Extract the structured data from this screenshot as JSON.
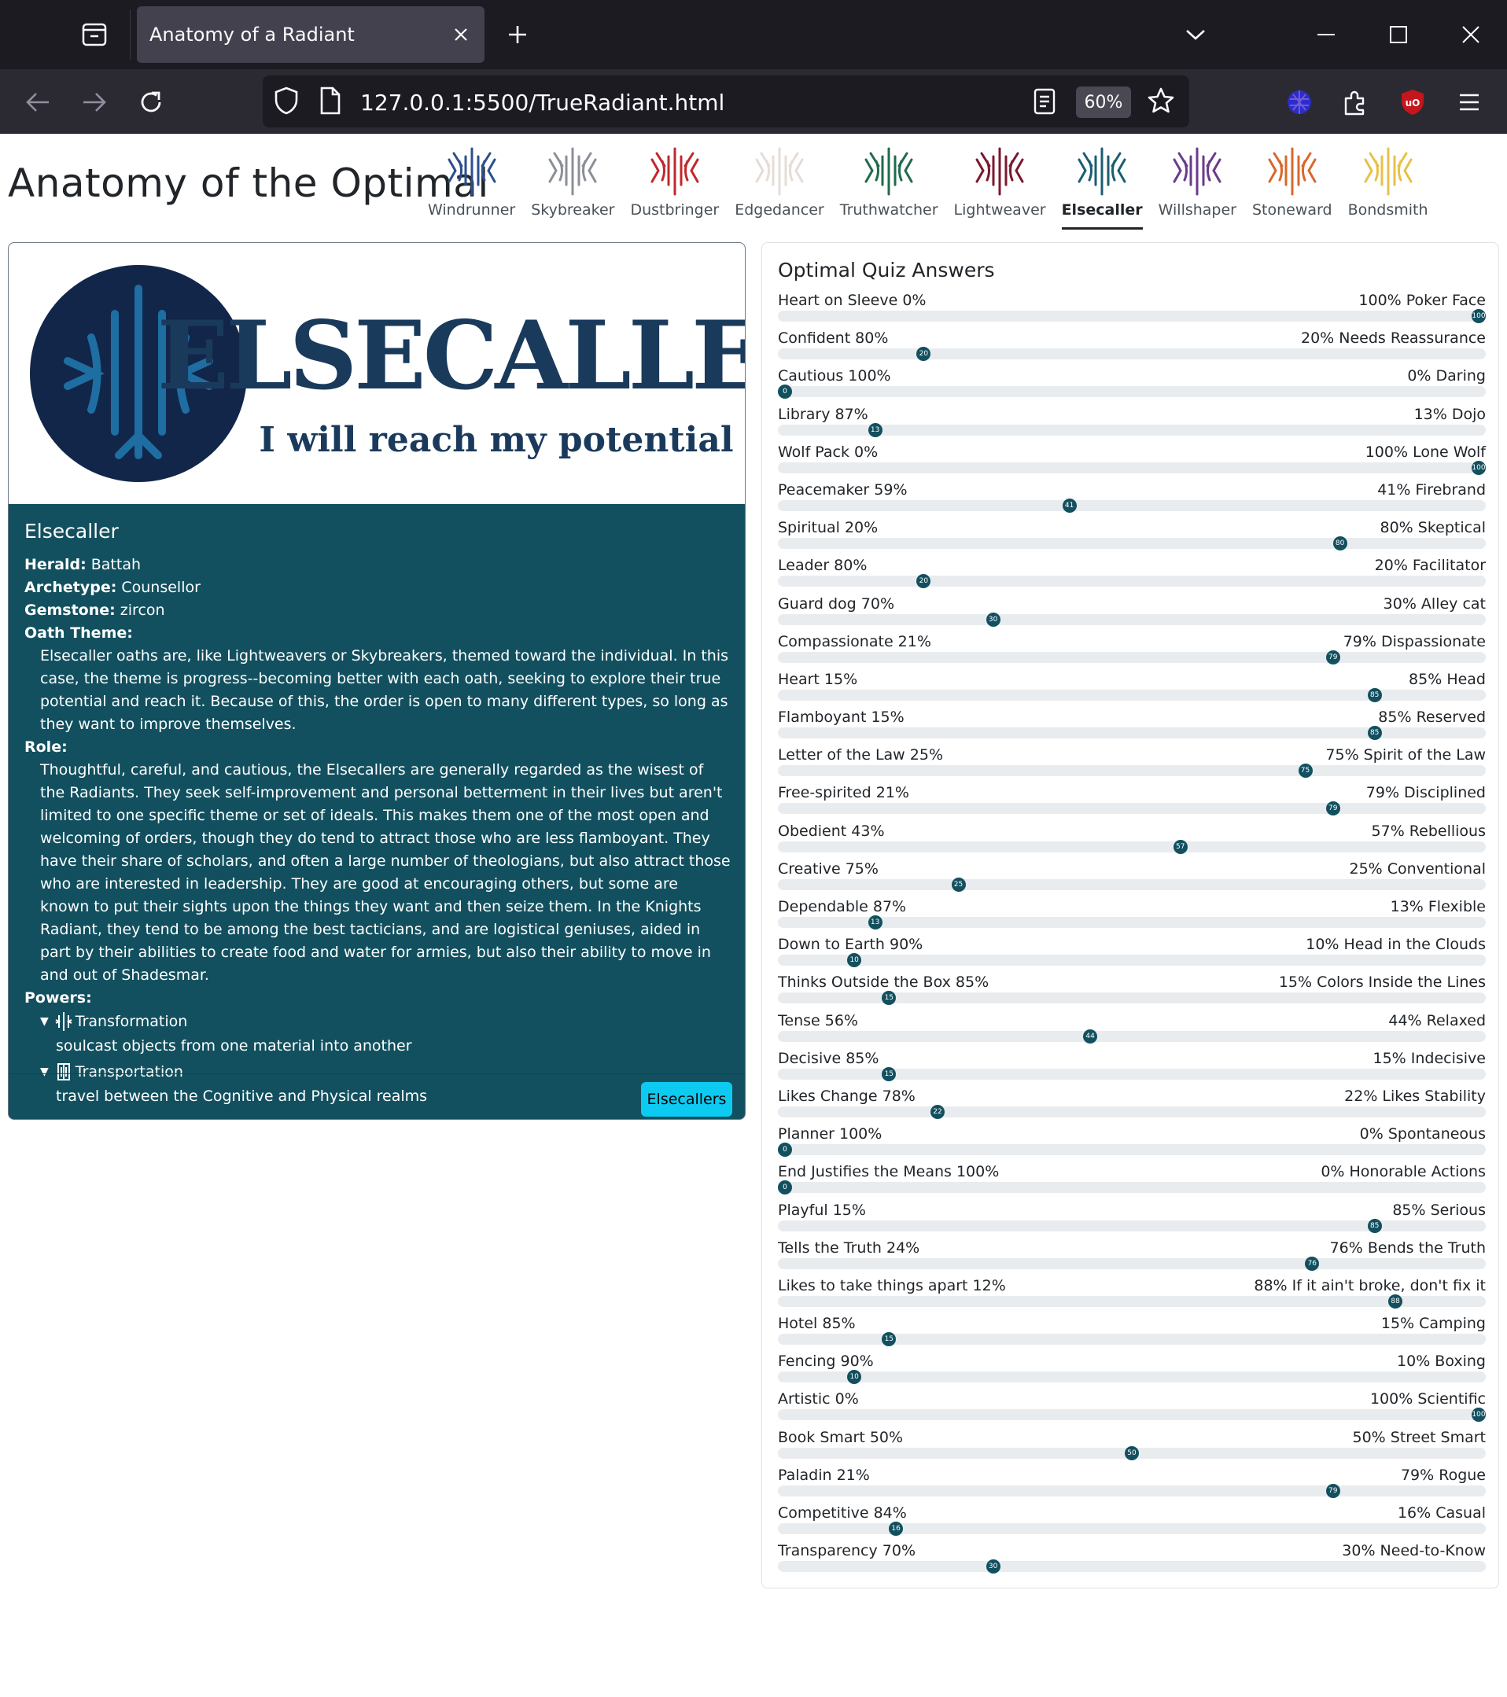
{
  "browser": {
    "tab_title": "Anatomy of a Radiant",
    "url": "127.0.0.1:5500/TrueRadiant.html",
    "zoom": "60%"
  },
  "site": {
    "title": "Anatomy of the Optimal",
    "orders": [
      {
        "label": "Windrunner",
        "color": "#2b4f8c"
      },
      {
        "label": "Skybreaker",
        "color": "#8a8f98"
      },
      {
        "label": "Dustbringer",
        "color": "#c0282d"
      },
      {
        "label": "Edgedancer",
        "color": "#e6dcd6"
      },
      {
        "label": "Truthwatcher",
        "color": "#1f6b4a"
      },
      {
        "label": "Lightweaver",
        "color": "#7b1830"
      },
      {
        "label": "Elsecaller",
        "color": "#1a5d72"
      },
      {
        "label": "Willshaper",
        "color": "#6a3a8c"
      },
      {
        "label": "Stoneward",
        "color": "#d9682a"
      },
      {
        "label": "Bondsmith",
        "color": "#e8c04a"
      }
    ],
    "active_order": "Elsecaller"
  },
  "card": {
    "banner_title": "ELSECALLER",
    "banner_motto": "I will reach my potential",
    "name": "Elsecaller",
    "herald_label": "Herald:",
    "herald": "Battah",
    "archetype_label": "Archetype:",
    "archetype": "Counsellor",
    "gemstone_label": "Gemstone:",
    "gemstone": "zircon",
    "oath_label": "Oath Theme:",
    "oath_text": "Elsecaller oaths are, like Lightweavers or Skybreakers, themed toward the individual. In this case, the theme is progress--becoming better with each oath, seeking to explore their true potential and reach it. Because of this, the order is open to many different types, so long as they want to improve themselves.",
    "role_label": "Role:",
    "role_text": "Thoughtful, careful, and cautious, the Elsecallers are generally regarded as the wisest of the Radiants. They seek self-improvement and personal betterment in their lives but aren't limited to one specific theme or set of ideals. This makes them one of the most open and welcoming of orders, though they do tend to attract those who are less flamboyant. They have their share of scholars, and often a large number of theologians, but also attract those who are interested in leadership. They are good at encouraging others, but some are known to put their sights upon the things they want and then seize them. In the Knights Radiant, they tend to be among the best tacticians, and are logistical geniuses, aided in part by their abilities to create food and water for armies, but also their ability to move in and out of Shadesmar.",
    "powers_label": "Powers:",
    "powers": [
      {
        "name": "Transformation",
        "desc": "soulcast objects from one material into another"
      },
      {
        "name": "Transportation",
        "desc": "travel between the Cognitive and Physical realms"
      }
    ],
    "button_label": "Elsecallers",
    "accent": "#12505f"
  },
  "quiz": {
    "title": "Optimal Quiz Answers",
    "rows": [
      {
        "left": "Heart on Sleeve 0%",
        "right": "100% Poker Face",
        "value": 100
      },
      {
        "left": "Confident 80%",
        "right": "20% Needs Reassurance",
        "value": 20
      },
      {
        "left": "Cautious 100%",
        "right": "0% Daring",
        "value": 0
      },
      {
        "left": "Library 87%",
        "right": "13% Dojo",
        "value": 13
      },
      {
        "left": "Wolf Pack 0%",
        "right": "100% Lone Wolf",
        "value": 100
      },
      {
        "left": "Peacemaker 59%",
        "right": "41% Firebrand",
        "value": 41
      },
      {
        "left": "Spiritual 20%",
        "right": "80% Skeptical",
        "value": 80
      },
      {
        "left": "Leader 80%",
        "right": "20% Facilitator",
        "value": 20
      },
      {
        "left": "Guard dog 70%",
        "right": "30% Alley cat",
        "value": 30
      },
      {
        "left": "Compassionate 21%",
        "right": "79% Dispassionate",
        "value": 79
      },
      {
        "left": "Heart 15%",
        "right": "85% Head",
        "value": 85
      },
      {
        "left": "Flamboyant 15%",
        "right": "85% Reserved",
        "value": 85
      },
      {
        "left": "Letter of the Law 25%",
        "right": "75% Spirit of the Law",
        "value": 75
      },
      {
        "left": "Free-spirited 21%",
        "right": "79% Disciplined",
        "value": 79
      },
      {
        "left": "Obedient 43%",
        "right": "57% Rebellious",
        "value": 57
      },
      {
        "left": "Creative 75%",
        "right": "25% Conventional",
        "value": 25
      },
      {
        "left": "Dependable 87%",
        "right": "13% Flexible",
        "value": 13
      },
      {
        "left": "Down to Earth 90%",
        "right": "10% Head in the Clouds",
        "value": 10
      },
      {
        "left": "Thinks Outside the Box 85%",
        "right": "15% Colors Inside the Lines",
        "value": 15
      },
      {
        "left": "Tense 56%",
        "right": "44% Relaxed",
        "value": 44
      },
      {
        "left": "Decisive 85%",
        "right": "15% Indecisive",
        "value": 15
      },
      {
        "left": "Likes Change 78%",
        "right": "22% Likes Stability",
        "value": 22
      },
      {
        "left": "Planner 100%",
        "right": "0% Spontaneous",
        "value": 0
      },
      {
        "left": "End Justifies the Means 100%",
        "right": "0% Honorable Actions",
        "value": 0
      },
      {
        "left": "Playful 15%",
        "right": "85% Serious",
        "value": 85
      },
      {
        "left": "Tells the Truth 24%",
        "right": "76% Bends the Truth",
        "value": 76
      },
      {
        "left": "Likes to take things apart 12%",
        "right": "88% If it ain't broke, don't fix it",
        "value": 88
      },
      {
        "left": "Hotel 85%",
        "right": "15% Camping",
        "value": 15
      },
      {
        "left": "Fencing 90%",
        "right": "10% Boxing",
        "value": 10
      },
      {
        "left": "Artistic 0%",
        "right": "100% Scientific",
        "value": 100
      },
      {
        "left": "Book Smart 50%",
        "right": "50% Street Smart",
        "value": 50
      },
      {
        "left": "Paladin 21%",
        "right": "79% Rogue",
        "value": 79
      },
      {
        "left": "Competitive 84%",
        "right": "16% Casual",
        "value": 16
      },
      {
        "left": "Transparency 70%",
        "right": "30% Need-to-Know",
        "value": 30
      }
    ]
  }
}
